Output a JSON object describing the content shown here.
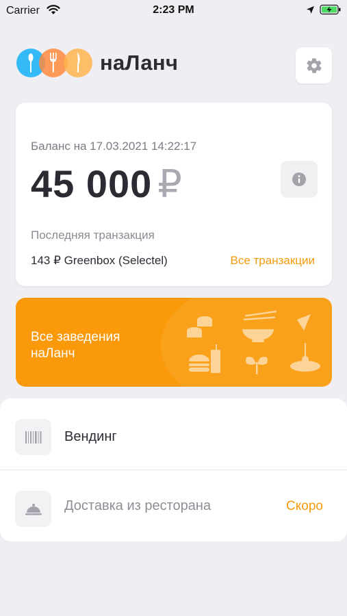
{
  "status_bar": {
    "carrier": "Carrier",
    "time": "2:23 PM"
  },
  "header": {
    "brand": "наЛанч",
    "settings_icon": "gear-icon"
  },
  "balance": {
    "date_label": "Баланс на 17.03.2021 14:22:17",
    "amount": "45 000",
    "currency": "₽",
    "last_tx_label": "Последняя транзакция",
    "last_tx_value": "143 ₽ Greenbox (Selectel)",
    "all_tx_link": "Все транзакции"
  },
  "places_banner": {
    "title": "Все заведения наЛанч"
  },
  "services": [
    {
      "label": "Вендинг",
      "icon": "barcode-icon"
    },
    {
      "label": "Доставка из ресторана",
      "icon": "cloche-icon",
      "badge": "Скоро"
    }
  ],
  "colors": {
    "accent": "#fa9a0b",
    "link": "#f59a0e",
    "logo_blue": "#29b6f6",
    "logo_orange": "#ff9f3a",
    "logo_gold": "#ffb54d",
    "background": "#efeff3",
    "text": "#2b2b33"
  }
}
